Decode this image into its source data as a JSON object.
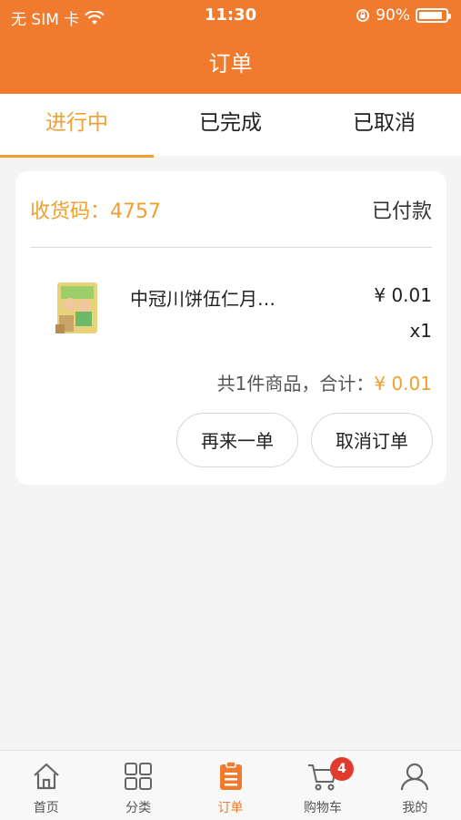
{
  "status_bar": {
    "carrier": "无 SIM 卡",
    "time": "11:30",
    "battery": "90%",
    "battery_level": 0.9
  },
  "header": {
    "title": "订单"
  },
  "tabs": [
    {
      "label": "进行中",
      "active": true
    },
    {
      "label": "已完成",
      "active": false
    },
    {
      "label": "已取消",
      "active": false
    }
  ],
  "order": {
    "pickup_label": "收货码：",
    "pickup_code": "4757",
    "status": "已付款",
    "item": {
      "name": "中冠川饼伍仁月…",
      "price": "¥ 0.01",
      "qty": "x1"
    },
    "summary_label": "共1件商品，合计：",
    "summary_amount": "¥ 0.01",
    "buttons": {
      "reorder": "再来一单",
      "cancel": "取消订单"
    }
  },
  "tabbar": {
    "items": [
      {
        "label": "首页",
        "icon": "home-icon"
      },
      {
        "label": "分类",
        "icon": "grid-icon"
      },
      {
        "label": "订单",
        "icon": "clipboard-icon",
        "active": true
      },
      {
        "label": "购物车",
        "icon": "cart-icon",
        "badge": "4"
      },
      {
        "label": "我的",
        "icon": "user-icon"
      }
    ]
  },
  "colors": {
    "brand": "#f07a2e",
    "accent": "#f0a030",
    "badge": "#e23a2e"
  }
}
